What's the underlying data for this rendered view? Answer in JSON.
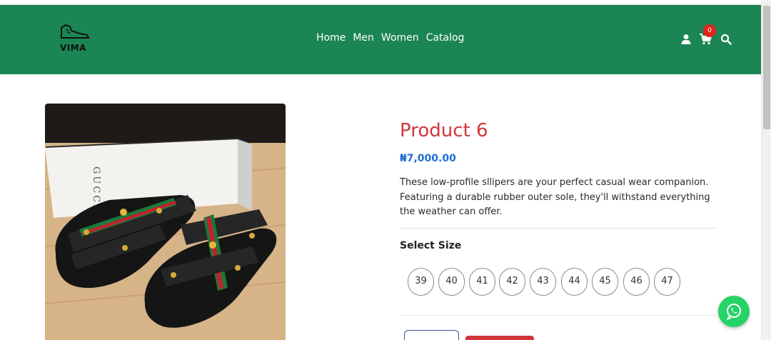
{
  "brand": {
    "logo_text": "VIMA"
  },
  "nav": {
    "links": [
      {
        "label": "Home"
      },
      {
        "label": "Men"
      },
      {
        "label": "Women"
      },
      {
        "label": "Catalog"
      }
    ],
    "cart_count": "0",
    "icons": [
      "user-icon",
      "cart-icon",
      "search-icon"
    ]
  },
  "colors": {
    "navbar": "#1b8553",
    "title": "#d0363c",
    "price": "#1f6fd6",
    "badge": "#e0241c",
    "whatsapp": "#25d366",
    "add_button": "#d0363c"
  },
  "product": {
    "title": "Product 6",
    "price": "₦7,000.00",
    "description": "These low-profile sllipers are your perfect casual wear companion. Featuring a durable rubber outer sole, they'll withstand everything the weather can offer.",
    "image_box_text": "GUCCI",
    "size_label": "Select Size",
    "sizes": [
      "39",
      "40",
      "41",
      "42",
      "43",
      "44",
      "45",
      "46",
      "47"
    ]
  },
  "widgets": {
    "whatsapp_icon": "whatsapp-icon"
  }
}
